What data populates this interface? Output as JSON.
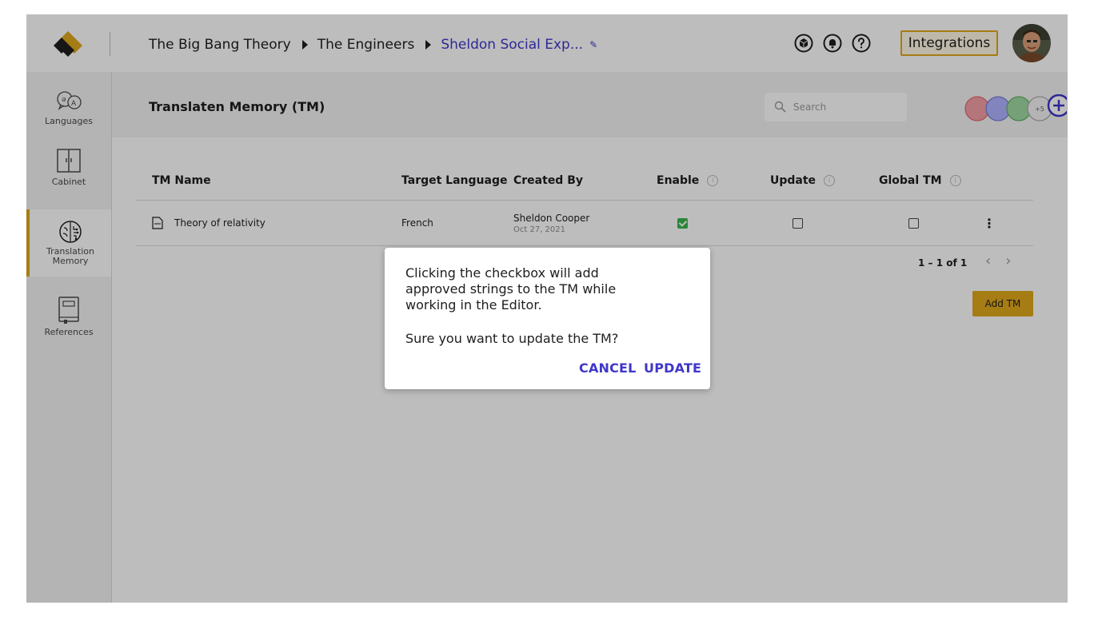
{
  "header": {
    "breadcrumbs": [
      "The Big Bang Theory",
      "The Engineers",
      "Sheldon Social Exp..."
    ],
    "integrations_label": "Integrations",
    "icons": [
      "cube-icon",
      "bell-icon",
      "help-icon"
    ]
  },
  "sidebar": {
    "items": [
      {
        "label": "Languages",
        "icon": "languages-icon"
      },
      {
        "label": "Cabinet",
        "icon": "cabinet-icon"
      },
      {
        "label": "Translation Memory",
        "icon": "brain-icon",
        "active": true
      },
      {
        "label": "References",
        "icon": "book-icon"
      }
    ]
  },
  "main": {
    "title": "Translaten Memory (TM)",
    "search_placeholder": "Search",
    "collaborators_more": "+5"
  },
  "table": {
    "columns": [
      "TM Name",
      "Target Language",
      "Created By",
      "Enable",
      "Update",
      "Global TM"
    ],
    "rows": [
      {
        "name": "Theory of relativity",
        "language": "French",
        "created_by": "Sheldon Cooper",
        "created_date": "Oct 27, 2021",
        "enable": true,
        "update": false,
        "global_tm": false
      }
    ]
  },
  "pagination": {
    "label": "1 – 1 of 1"
  },
  "add_tm_label": "Add TM",
  "dialog": {
    "message": "Clicking the checkbox will add approved strings to the TM while working in the Editor.",
    "question": "Sure you want to update the TM?",
    "cancel_label": "CANCEL",
    "update_label": "UPDATE"
  },
  "colors": {
    "accent": "#e0a81c",
    "link": "#3f37c9",
    "checkbox_on": "#3ab54a"
  }
}
